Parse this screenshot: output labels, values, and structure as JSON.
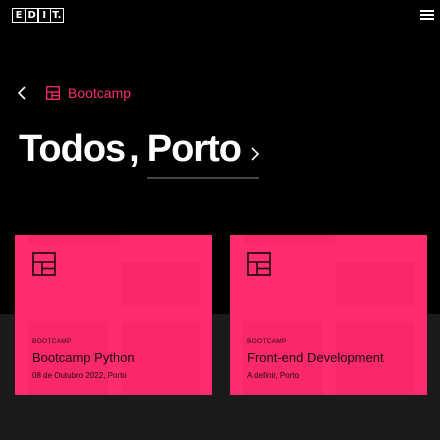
{
  "header": {
    "logo_letters": [
      "E",
      "D",
      "I",
      "T."
    ],
    "menu_icon": "hamburger-icon"
  },
  "breadcrumb": {
    "label": "Bootcamp",
    "back_icon": "chevron-left-icon",
    "category_icon": "grid-layout-icon"
  },
  "title": {
    "prefix": "Todos",
    "comma": ",",
    "location": "Porto",
    "chevron_icon": "chevron-right-icon"
  },
  "colors": {
    "accent": "#ff2d6f",
    "background": "#000000",
    "lower_background": "#1a1a1a"
  },
  "cards": [
    {
      "tag": "BOOTCAMP",
      "name": "Bootcamp Python",
      "meta": "08 de Outubro 2022, Porto"
    },
    {
      "tag": "BOOTCAMP",
      "name": "Front-end Development",
      "meta": "A definir, Porto"
    }
  ]
}
